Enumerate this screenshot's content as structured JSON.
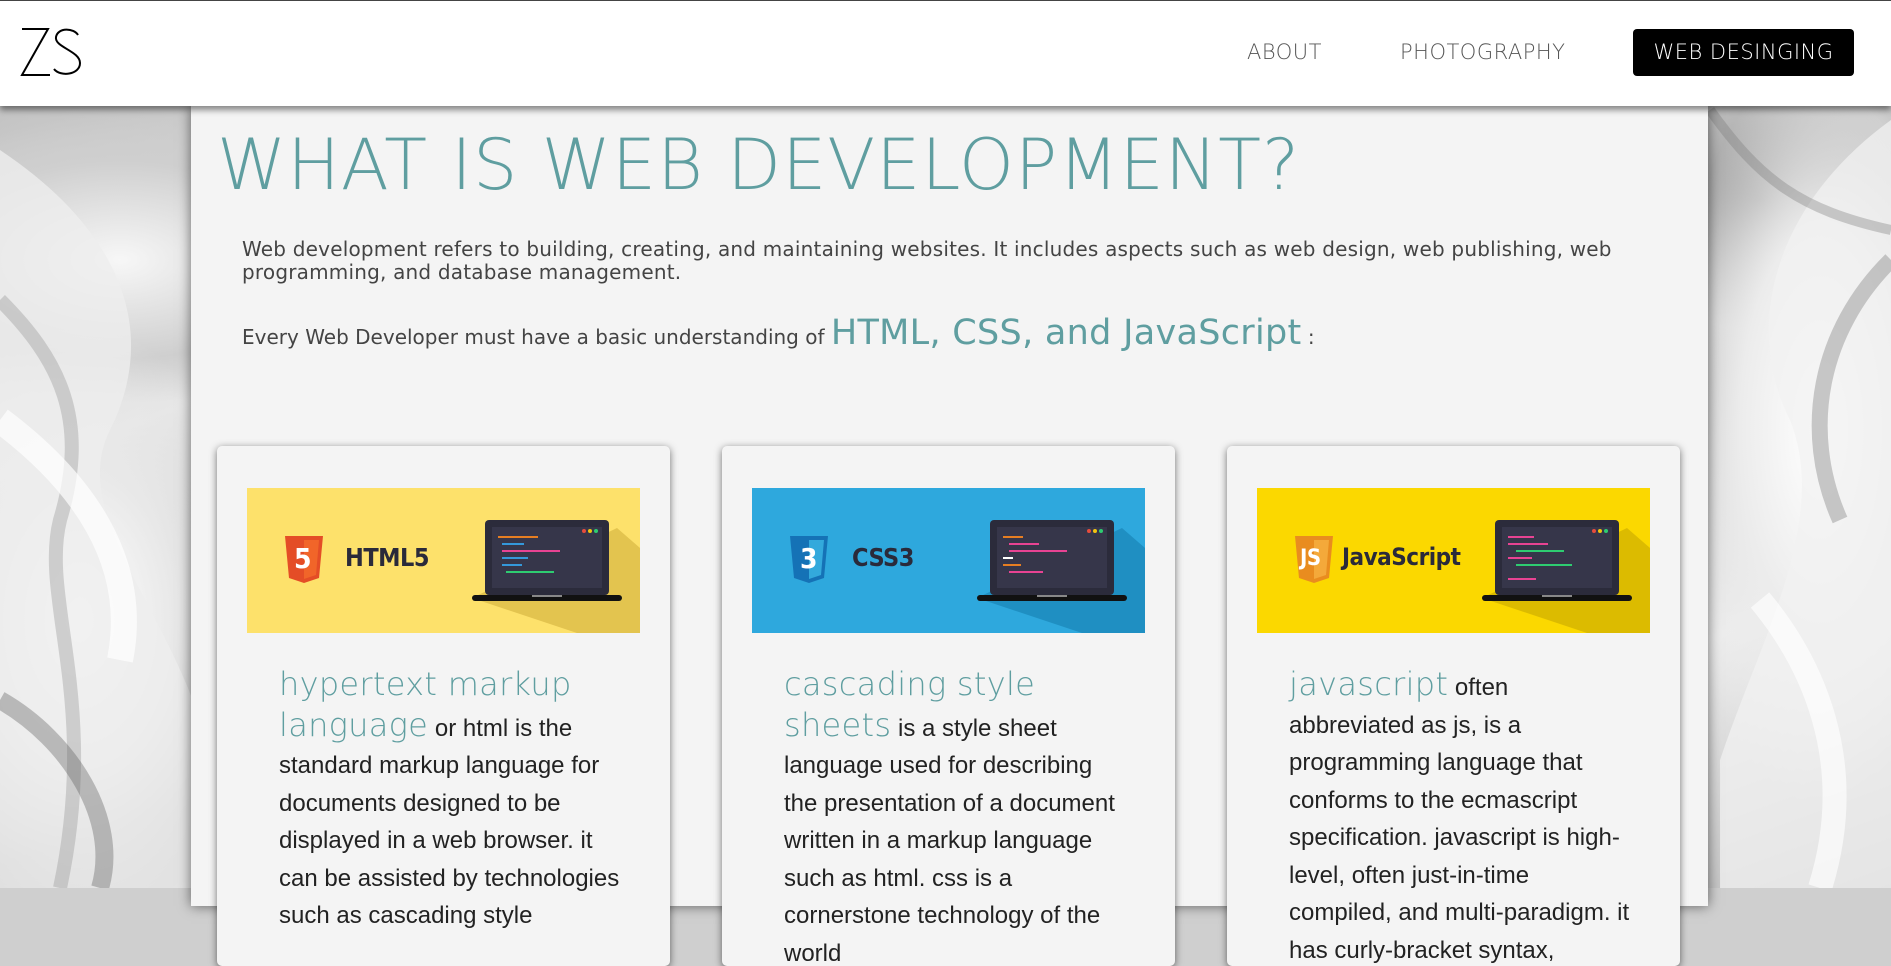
{
  "logo": "ZS",
  "nav": {
    "about": "ABOUT",
    "photography": "PHOTOGRAPHY",
    "web_designing": "WEB DESINGING"
  },
  "main": {
    "title": "WHAT IS WEB DEVELOPMENT?",
    "intro": "Web development refers to building, creating, and maintaining websites. It includes aspects such as web design, web publishing, web programming, and database management.",
    "intro2_prefix": "Every Web Developer must have a basic understanding of ",
    "intro2_highlight": "HTML, CSS, and JavaScript",
    "intro2_suffix": " :"
  },
  "cards": [
    {
      "banner_label": "HTML5",
      "banner_badge": "5",
      "banner_color": "#fde16b",
      "term": "hypertext markup language",
      "text": " or html is the standard markup language for documents designed to be displayed in a web browser. it can be assisted by technologies such as cascading style"
    },
    {
      "banner_label": "CSS3",
      "banner_badge": "3",
      "banner_color": "#2ea8dd",
      "term": "cascading style sheets",
      "text": " is a style sheet language used for describing the presentation of a document written in a markup language such as html. css is a cornerstone technology of the world"
    },
    {
      "banner_label": "JavaScript",
      "banner_badge": "JS",
      "banner_color": "#fbd800",
      "term": "javascript",
      "text": " often abbreviated as js, is a programming language that conforms to the ecmascript specification. javascript is high-level, often just-in-time compiled, and multi-paradigm. it has curly-bracket syntax,"
    }
  ]
}
